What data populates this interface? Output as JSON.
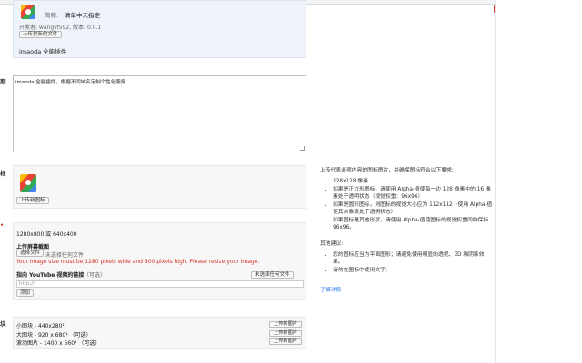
{
  "store": {
    "short_name_label": "简称:",
    "short_name_value": "清单中未指定",
    "developer_label": "开发者: wangyf592, 版本: 0.0.1",
    "upload_update_button": "上传更新的文件",
    "item_name": "imaoda 全能插件"
  },
  "summary": {
    "side_label": "期",
    "text": "imaoda 全能插件，根据不同域名定制个性化服务"
  },
  "icon_section": {
    "side_label": "标",
    "upload_button": "上传新图标"
  },
  "screenshot_section": {
    "dimensions": "1280x800 或 640x400",
    "title": "上传屏幕截图",
    "choose_file_button": "选择文件",
    "no_file_text": "未选择任何文件",
    "error": "Your image size must be 1280 pixels wide and 800 pixels high. Please resize your image.",
    "tooltip": "未选择任何文件",
    "youtube_label": "指向 YouTube 视频的链接",
    "youtube_optional": "（可选）",
    "youtube_placeholder": "http://",
    "add_button": "添加"
  },
  "tiles_section": {
    "side_label": "块",
    "rows": [
      {
        "label": "小图块 - 440x280¹",
        "button": "上传新图片"
      },
      {
        "label": "大图块 - 920 x 680¹  （可选）",
        "button": "上传新图片"
      },
      {
        "label": "滚动图片 - 1400 x 560¹  （可选）",
        "button": "上传新图片"
      }
    ]
  },
  "icon_help": {
    "intro": "上传代表此项内容的图标图片，并确保图标符合以下要求:",
    "requirements": [
      "128x128 像素",
      "如果是正方形图标，请使用 Alpha-值使每一边 128 像素中的 16 像素处于透明状态（视觉权重：96x96）",
      "如果是圆形图标，则图标的视觉大小应为 112x112（使用 Alpha-值使其余像素处于透明状态）",
      "如果图标是其他形状，请使用 Alpha-值使图标的视觉权重同样保持 96x96。"
    ],
    "other_suggestions_title": "其他建议:",
    "suggestions": [
      "您的图标应当为平面图形；请避免使用明显的透视、3D 和阴影效果。",
      "请勿在图标中使用文字。"
    ],
    "learn_more": "了解详情"
  }
}
